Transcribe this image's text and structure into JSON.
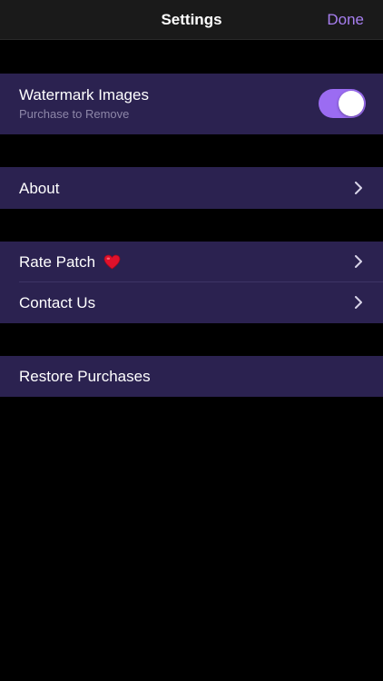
{
  "nav": {
    "title": "Settings",
    "done_label": "Done"
  },
  "watermark": {
    "label": "Watermark Images",
    "sublabel": "Purchase to Remove",
    "toggle_on": true
  },
  "about": {
    "label": "About"
  },
  "rate": {
    "label": "Rate Patch",
    "emoji_icon": "heart-icon"
  },
  "contact": {
    "label": "Contact Us"
  },
  "restore": {
    "label": "Restore Purchases"
  },
  "colors": {
    "background": "#000000",
    "nav_background": "#1a1a1a",
    "cell_background": "#2b2250",
    "accent": "#a77ff0",
    "toggle_on": "#9b6cf2",
    "sublabel": "#8d86a8"
  }
}
